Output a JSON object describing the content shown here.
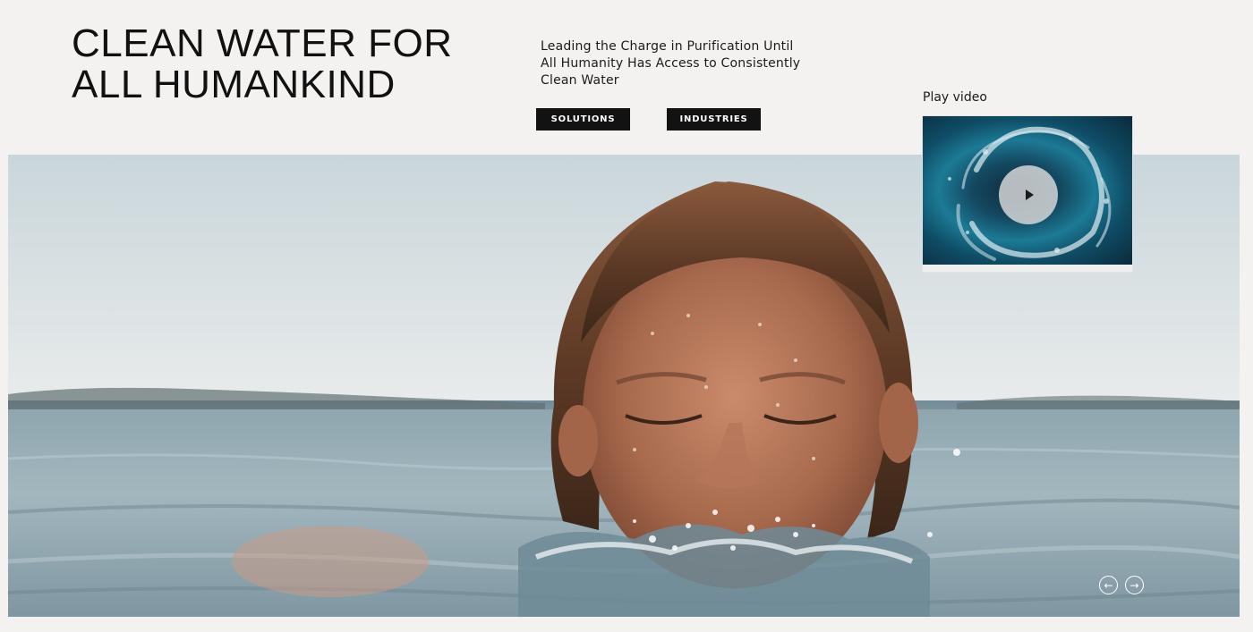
{
  "header": {
    "headline": "CLEAN WATER FOR ALL HUMANKIND",
    "tagline": "Leading the Charge in Purification Until All Humanity Has Access to Consistently Clean Water",
    "buttons": {
      "solutions_label": "SOLUTIONS",
      "industries_label": "INDUSTRIES"
    }
  },
  "video": {
    "label": "Play video",
    "play_icon": "play-icon"
  },
  "hero": {
    "image_description_icon": "hero-photo",
    "prev_icon": "←",
    "next_icon": "→"
  },
  "colors": {
    "background": "#f3f2f0",
    "button": "#121212",
    "button_text": "#ffffff",
    "text": "#111111"
  }
}
